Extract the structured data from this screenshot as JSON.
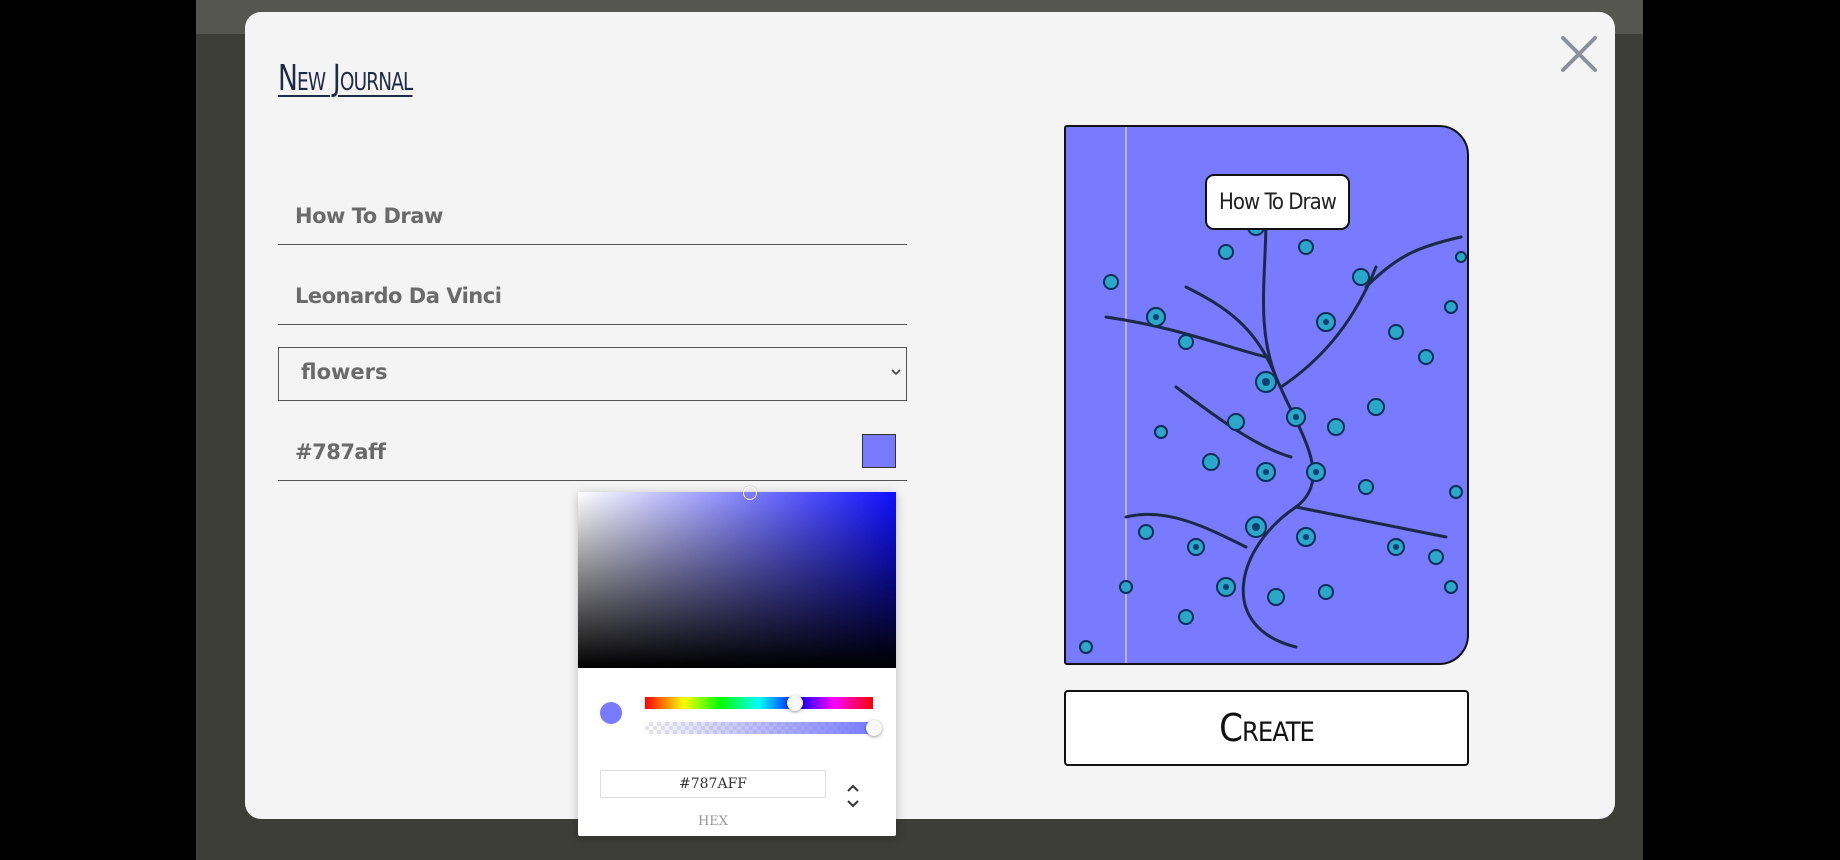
{
  "modal": {
    "title": "New Journal"
  },
  "form": {
    "title_value": "How To Draw",
    "author_value": "Leonardo Da Vinci",
    "theme_selected": "flowers",
    "color_value": "#787aff"
  },
  "color_picker": {
    "hex_value": "#787AFF",
    "mode_label": "HEX",
    "hue_fraction": 0.67,
    "alpha_fraction": 1.0
  },
  "preview": {
    "cover_label": "How To Draw",
    "cover_color": "#787aff",
    "pattern": "flowers"
  },
  "actions": {
    "create_label": "Create"
  },
  "icons": {
    "close": "close-icon",
    "dropdown": "chevron-down-icon",
    "mode_toggle": "up-down-chevron-icon"
  }
}
